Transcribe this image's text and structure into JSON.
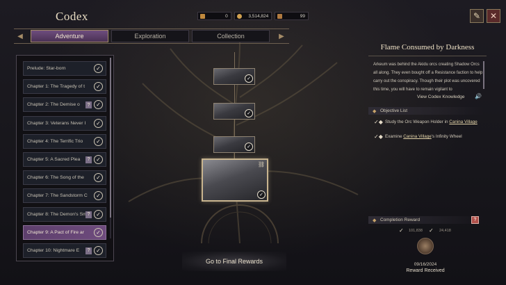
{
  "header": {
    "title": "Codex",
    "currencies": [
      {
        "icon": "feather-icon",
        "value": "0"
      },
      {
        "icon": "coin-icon",
        "value": "3,514,824"
      },
      {
        "icon": "gem-icon",
        "value": "99"
      }
    ]
  },
  "tabs": [
    {
      "label": "Adventure",
      "active": true
    },
    {
      "label": "Exploration",
      "active": false
    },
    {
      "label": "Collection",
      "active": false
    }
  ],
  "chapters": [
    {
      "label": "Prelude: Star-born",
      "completed": true,
      "has_badge": false,
      "active": false
    },
    {
      "label": "Chapter 1: The Tragedy of t",
      "completed": true,
      "has_badge": false,
      "active": false
    },
    {
      "label": "Chapter 2: The Demise o",
      "completed": true,
      "has_badge": true,
      "active": false
    },
    {
      "label": "Chapter 3: Veterans Never I",
      "completed": true,
      "has_badge": false,
      "active": false
    },
    {
      "label": "Chapter 4: The Terrific Trio",
      "completed": true,
      "has_badge": false,
      "active": false
    },
    {
      "label": "Chapter 5: A Sacred Plea",
      "completed": true,
      "has_badge": true,
      "active": false
    },
    {
      "label": "Chapter 6: The Song of the",
      "completed": true,
      "has_badge": false,
      "active": false
    },
    {
      "label": "Chapter 7: The Sandstorm C",
      "completed": true,
      "has_badge": false,
      "active": false
    },
    {
      "label": "Chapter 8: The Demon's Sm",
      "completed": true,
      "has_badge": true,
      "active": false
    },
    {
      "label": "Chapter 9: A Pact of Fire ar",
      "completed": true,
      "has_badge": false,
      "active": true
    },
    {
      "label": "Chapter 10: Nightmare E",
      "completed": true,
      "has_badge": true,
      "active": false
    }
  ],
  "center": {
    "go_rewards_label": "Go to Final Rewards"
  },
  "quest": {
    "title": "Flame Consumed by Darkness",
    "description": "Arkeum was behind the Akidu orcs creating Shadow Orcs all along. They even bought off a Resistance faction to help carry out the conspiracy. Though their plot was uncovered this time, you will have to remain vigilant to",
    "view_knowledge_label": "View Codex Knowledge",
    "objective_header": "Objective List",
    "objectives": [
      {
        "prefix": "Study the Orc Weapon Holder in ",
        "link": "Canina Village",
        "suffix": ""
      },
      {
        "prefix": "Examine ",
        "link": "Canina Village",
        "suffix": "'s Infinity Wheel"
      }
    ],
    "completion_header": "Completion Reward",
    "rewards": [
      "101,838",
      "24,418"
    ],
    "reward_date": "09/16/2024",
    "reward_status": "Reward Received"
  }
}
